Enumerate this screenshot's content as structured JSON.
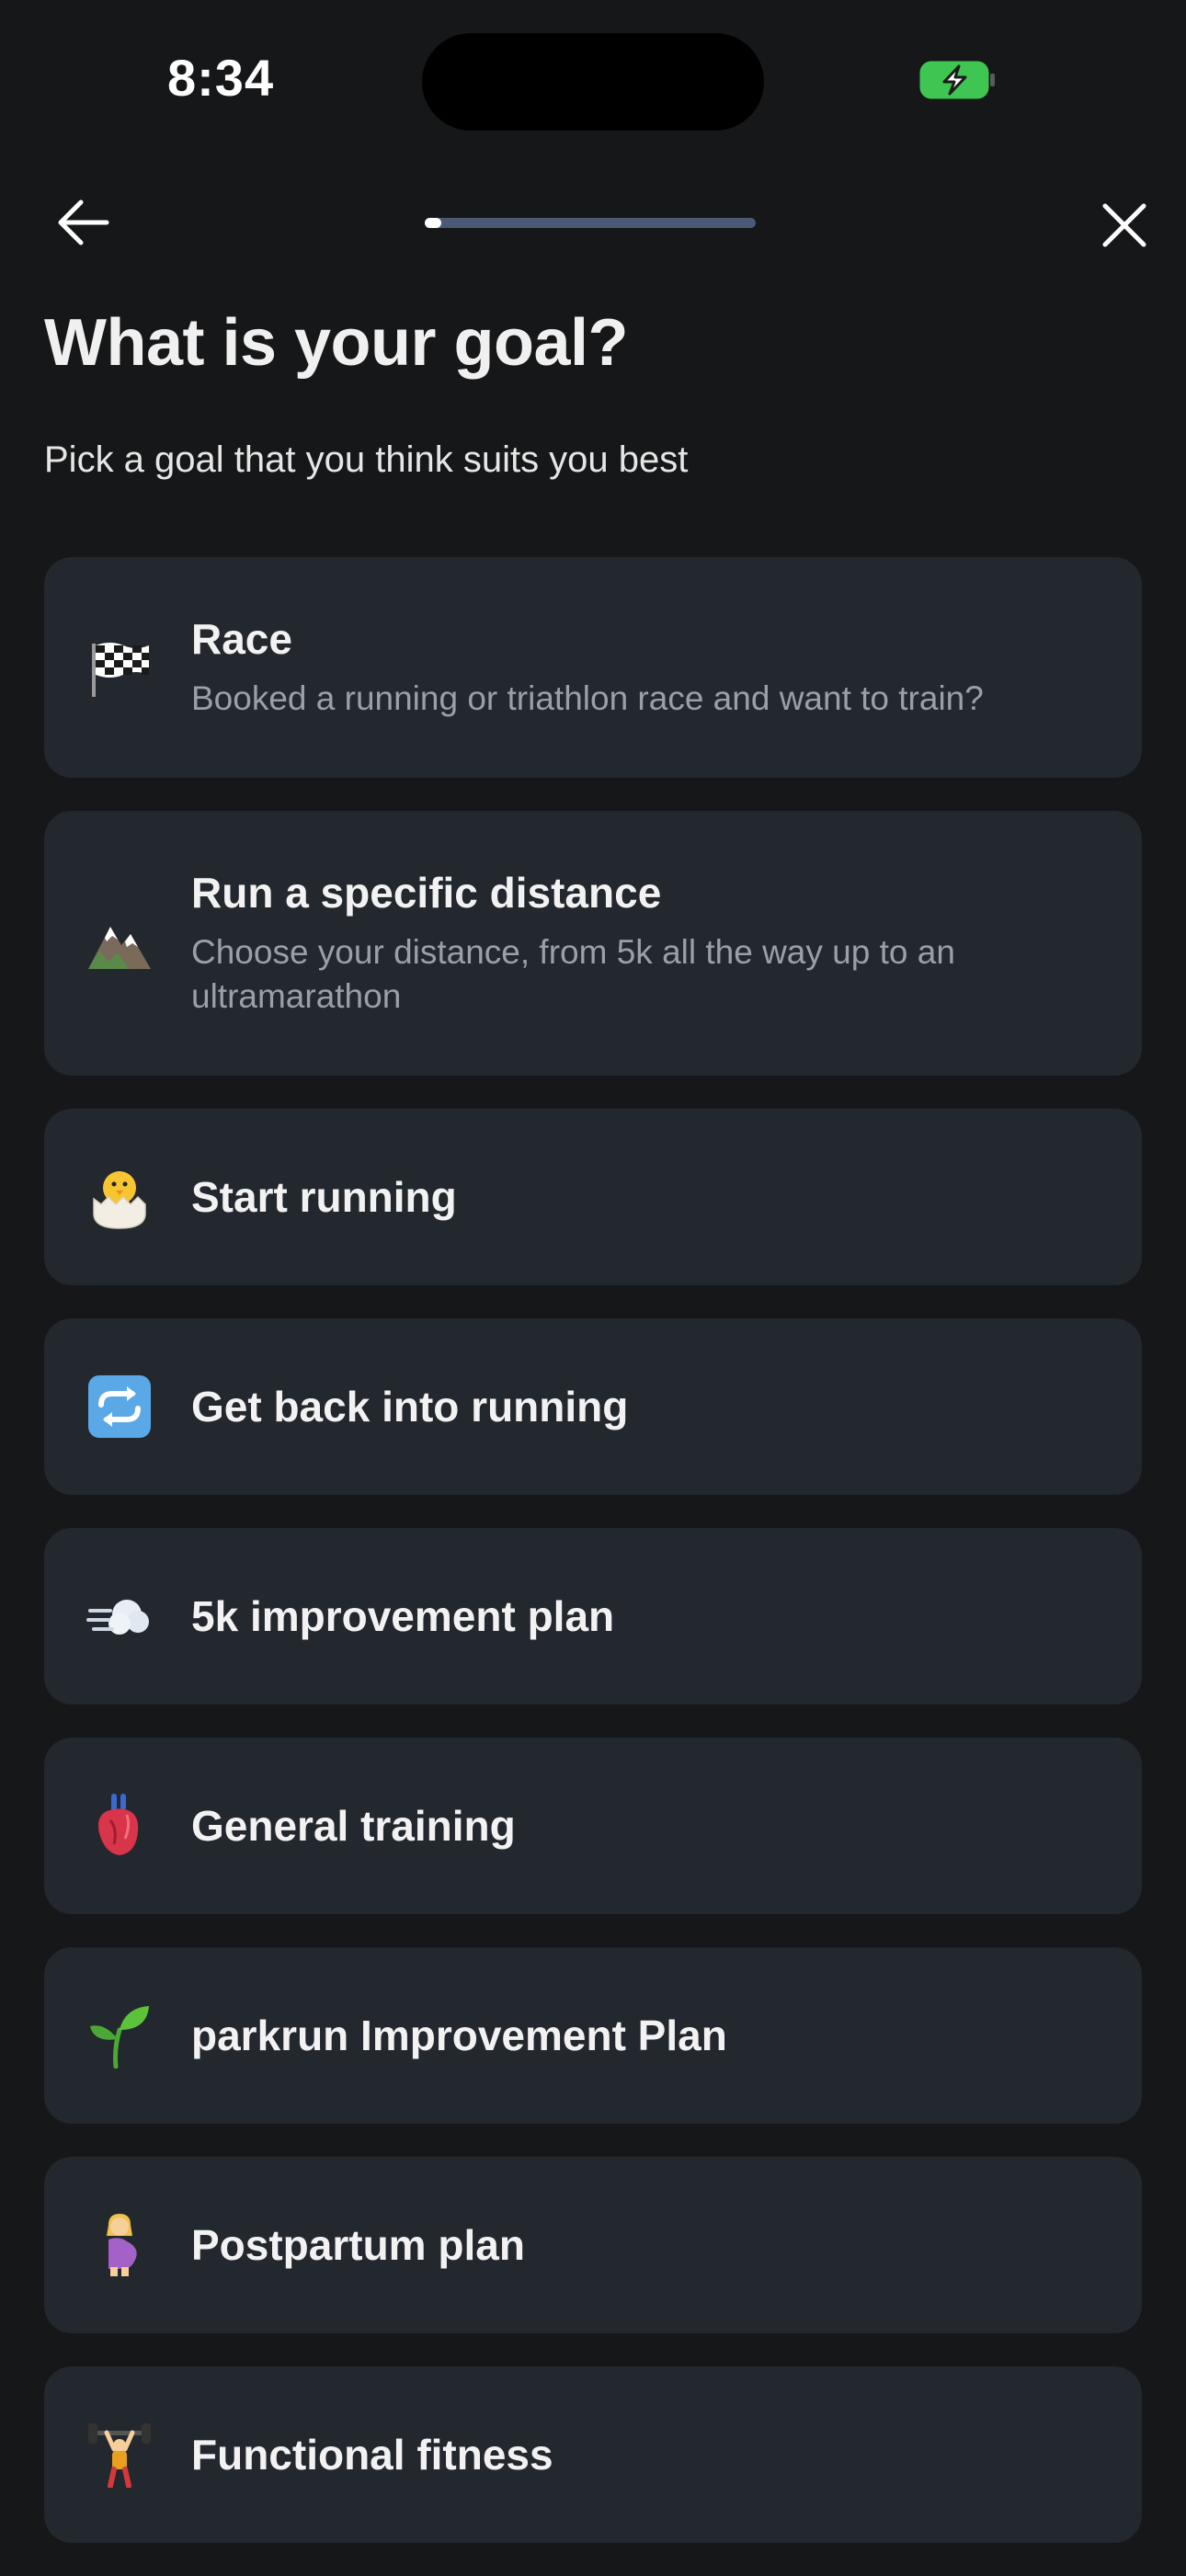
{
  "status_bar": {
    "time": "8:34"
  },
  "nav": {
    "progress_fraction": 0.05
  },
  "header": {
    "title": "What is your goal?",
    "subtitle": "Pick a goal that you think suits you best"
  },
  "goals": [
    {
      "icon": "chequered-flag-icon",
      "title": "Race",
      "description": "Booked a running or triathlon race and want to train?"
    },
    {
      "icon": "snow-capped-mountain-icon",
      "title": "Run a specific distance",
      "description": "Choose your distance, from 5k all the way up to an ultramarathon"
    },
    {
      "icon": "hatching-chick-icon",
      "title": "Start running"
    },
    {
      "icon": "repeat-arrows-icon",
      "title": "Get back into running"
    },
    {
      "icon": "dashing-away-icon",
      "title": "5k improvement plan"
    },
    {
      "icon": "anatomical-heart-icon",
      "title": "General training"
    },
    {
      "icon": "seedling-icon",
      "title": "parkrun Improvement Plan"
    },
    {
      "icon": "pregnant-woman-icon",
      "title": "Postpartum plan"
    },
    {
      "icon": "weight-lifter-icon",
      "title": "Functional fitness"
    }
  ],
  "colors": {
    "background": "#161718",
    "card": "#23272e",
    "progress_track": "#4a5a74",
    "battery_green": "#3ec552"
  }
}
